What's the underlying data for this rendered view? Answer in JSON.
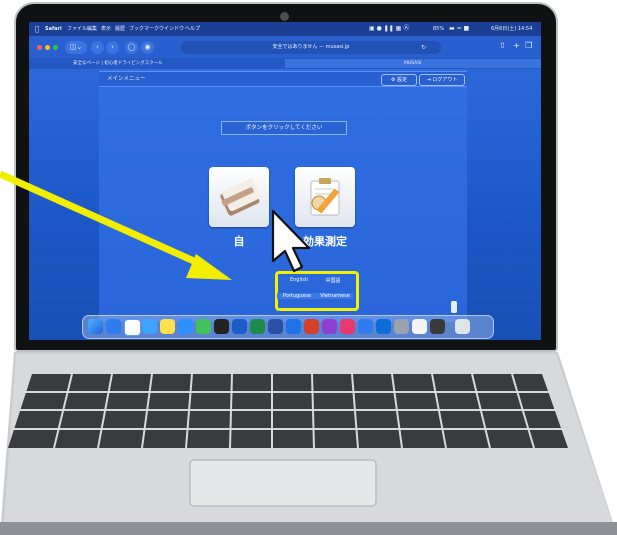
{
  "menubar": {
    "items": [
      "Safari",
      "ファイル",
      "編集",
      "表示",
      "履歴",
      "ブックマーク",
      "ウインドウ",
      "ヘルプ"
    ],
    "battery": "85%",
    "clock": "6月6日(土) 14:54"
  },
  "browser": {
    "url_text": "安全ではありません — musasi.jp",
    "tab_left": "安全なページ | 初心者ドライビングスクール",
    "tab_right": "MUSASI"
  },
  "page": {
    "header_title": "メインメニュー",
    "settings_label": "設定",
    "logout_label": "ログアウト",
    "prompt_text": "ボタンをクリックしてください",
    "tile_left_label": "自",
    "tile_right_label": "効果測定",
    "lang_english": "English",
    "lang_chinese": "中国語",
    "lang_portuguese": "Portuguese",
    "lang_vietnamese": "Vietnamese"
  },
  "colors": {
    "screen_blue": "#2a66d9",
    "highlight_yellow": "#f1f100",
    "arrow_yellow": "#f3ee00"
  },
  "icons": [
    "apple-icon",
    "traffic-lights",
    "sidebar-icon",
    "back-icon",
    "forward-icon",
    "shield-icon",
    "reload-icon",
    "share-icon",
    "new-tab-icon",
    "tabs-icon",
    "book-icon",
    "clipboard-pencil-icon",
    "cursor-arrow-icon",
    "dock-app-icons",
    "trash-icon"
  ]
}
